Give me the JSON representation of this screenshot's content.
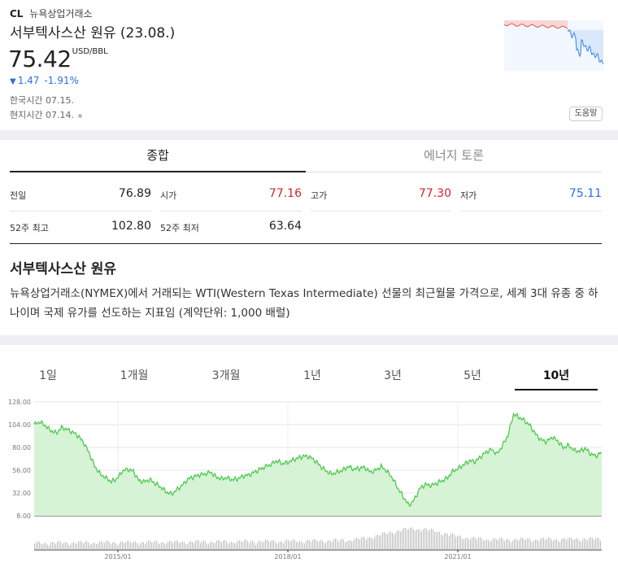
{
  "quote": {
    "code": "CL",
    "exchange": "뉴욕상업거래소",
    "name": "서부텍사스산 원유 (23.08.)",
    "price": "75.42",
    "unit": "USD/BBL",
    "change_arrow": "▼",
    "change": "1.47",
    "change_pct": "-1.91%",
    "korea_time": "한국시간 07.15.",
    "local_time": "현지시간 07.14.",
    "help_label": "도움말"
  },
  "colors": {
    "up": "#d2232a",
    "down": "#2e6ee0",
    "chart_line": "#4fc94f",
    "chart_fill": "#d6f3d6"
  },
  "tabs": [
    {
      "label": "종합",
      "active": true
    },
    {
      "label": "에너지 토론",
      "active": false
    }
  ],
  "stats": [
    {
      "label": "전일",
      "value": "76.89",
      "color": "neutral"
    },
    {
      "label": "시가",
      "value": "77.16",
      "color": "up"
    },
    {
      "label": "고가",
      "value": "77.30",
      "color": "up"
    },
    {
      "label": "저가",
      "value": "75.11",
      "color": "down"
    },
    {
      "label": "52주 최고",
      "value": "102.80",
      "color": "neutral"
    },
    {
      "label": "52주 최저",
      "value": "63.64",
      "color": "neutral"
    }
  ],
  "description": {
    "title": "서부텍사스산 원유",
    "body": "뉴욕상업거래소(NYMEX)에서 거래되는 WTI(Western Texas Intermediate) 선물의 최근월물 가격으로, 세계 3대 유종 중 하나이며 국제 유가를 선도하는 지표임 (계약단위: 1,000 배럴)"
  },
  "periods": [
    {
      "label": "1일",
      "active": false
    },
    {
      "label": "1개월",
      "active": false
    },
    {
      "label": "3개월",
      "active": false
    },
    {
      "label": "1년",
      "active": false
    },
    {
      "label": "3년",
      "active": false
    },
    {
      "label": "5년",
      "active": false
    },
    {
      "label": "10년",
      "active": true
    }
  ],
  "chart_data": {
    "type": "area",
    "y_ticks": [
      "128.00",
      "104.00",
      "80.00",
      "56.00",
      "32.00",
      "8.00"
    ],
    "ylim": [
      8,
      128
    ],
    "x_ticks": [
      "2015/01",
      "2018/01",
      "2021/01"
    ],
    "grid": true,
    "series": [
      {
        "values": [
          104,
          107,
          103,
          98,
          95,
          101,
          99,
          96,
          92,
          85,
          74,
          60,
          52,
          48,
          44,
          47,
          55,
          57,
          55,
          45,
          44,
          46,
          42,
          38,
          33,
          31,
          36,
          41,
          47,
          49,
          51,
          52,
          54,
          49,
          47,
          48,
          46,
          47,
          50,
          51,
          54,
          57,
          60,
          62,
          66,
          63,
          64,
          67,
          69,
          71,
          70,
          66,
          60,
          55,
          52,
          54,
          56,
          60,
          57,
          58,
          59,
          54,
          56,
          60,
          55,
          48,
          37,
          28,
          19,
          25,
          37,
          41,
          40,
          42,
          45,
          48,
          55,
          58,
          62,
          66,
          65,
          70,
          75,
          78,
          73,
          82,
          93,
          115,
          112,
          108,
          103,
          94,
          88,
          86,
          91,
          87,
          80,
          82,
          77,
          76,
          79,
          73,
          71,
          75
        ]
      }
    ],
    "volume_note": "volume bars below main chart"
  }
}
